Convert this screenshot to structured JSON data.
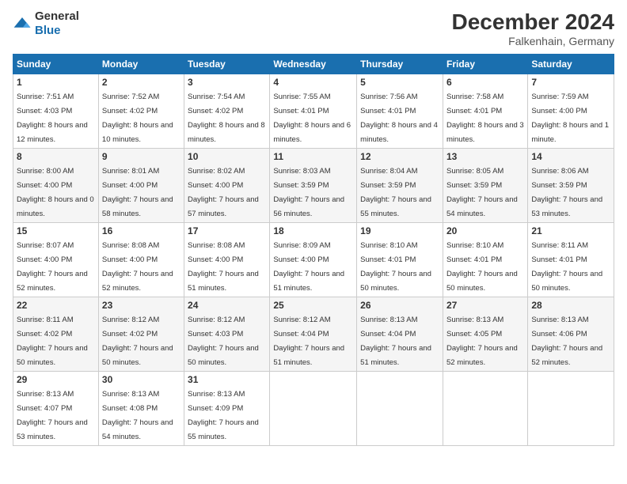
{
  "header": {
    "logo": {
      "general": "General",
      "blue": "Blue"
    },
    "title": "December 2024",
    "location": "Falkenhain, Germany"
  },
  "calendar": {
    "days_of_week": [
      "Sunday",
      "Monday",
      "Tuesday",
      "Wednesday",
      "Thursday",
      "Friday",
      "Saturday"
    ],
    "weeks": [
      [
        {
          "day": "1",
          "sunrise": "7:51 AM",
          "sunset": "4:03 PM",
          "daylight": "8 hours and 12 minutes."
        },
        {
          "day": "2",
          "sunrise": "7:52 AM",
          "sunset": "4:02 PM",
          "daylight": "8 hours and 10 minutes."
        },
        {
          "day": "3",
          "sunrise": "7:54 AM",
          "sunset": "4:02 PM",
          "daylight": "8 hours and 8 minutes."
        },
        {
          "day": "4",
          "sunrise": "7:55 AM",
          "sunset": "4:01 PM",
          "daylight": "8 hours and 6 minutes."
        },
        {
          "day": "5",
          "sunrise": "7:56 AM",
          "sunset": "4:01 PM",
          "daylight": "8 hours and 4 minutes."
        },
        {
          "day": "6",
          "sunrise": "7:58 AM",
          "sunset": "4:01 PM",
          "daylight": "8 hours and 3 minutes."
        },
        {
          "day": "7",
          "sunrise": "7:59 AM",
          "sunset": "4:00 PM",
          "daylight": "8 hours and 1 minute."
        }
      ],
      [
        {
          "day": "8",
          "sunrise": "8:00 AM",
          "sunset": "4:00 PM",
          "daylight": "8 hours and 0 minutes."
        },
        {
          "day": "9",
          "sunrise": "8:01 AM",
          "sunset": "4:00 PM",
          "daylight": "7 hours and 58 minutes."
        },
        {
          "day": "10",
          "sunrise": "8:02 AM",
          "sunset": "4:00 PM",
          "daylight": "7 hours and 57 minutes."
        },
        {
          "day": "11",
          "sunrise": "8:03 AM",
          "sunset": "3:59 PM",
          "daylight": "7 hours and 56 minutes."
        },
        {
          "day": "12",
          "sunrise": "8:04 AM",
          "sunset": "3:59 PM",
          "daylight": "7 hours and 55 minutes."
        },
        {
          "day": "13",
          "sunrise": "8:05 AM",
          "sunset": "3:59 PM",
          "daylight": "7 hours and 54 minutes."
        },
        {
          "day": "14",
          "sunrise": "8:06 AM",
          "sunset": "3:59 PM",
          "daylight": "7 hours and 53 minutes."
        }
      ],
      [
        {
          "day": "15",
          "sunrise": "8:07 AM",
          "sunset": "4:00 PM",
          "daylight": "7 hours and 52 minutes."
        },
        {
          "day": "16",
          "sunrise": "8:08 AM",
          "sunset": "4:00 PM",
          "daylight": "7 hours and 52 minutes."
        },
        {
          "day": "17",
          "sunrise": "8:08 AM",
          "sunset": "4:00 PM",
          "daylight": "7 hours and 51 minutes."
        },
        {
          "day": "18",
          "sunrise": "8:09 AM",
          "sunset": "4:00 PM",
          "daylight": "7 hours and 51 minutes."
        },
        {
          "day": "19",
          "sunrise": "8:10 AM",
          "sunset": "4:01 PM",
          "daylight": "7 hours and 50 minutes."
        },
        {
          "day": "20",
          "sunrise": "8:10 AM",
          "sunset": "4:01 PM",
          "daylight": "7 hours and 50 minutes."
        },
        {
          "day": "21",
          "sunrise": "8:11 AM",
          "sunset": "4:01 PM",
          "daylight": "7 hours and 50 minutes."
        }
      ],
      [
        {
          "day": "22",
          "sunrise": "8:11 AM",
          "sunset": "4:02 PM",
          "daylight": "7 hours and 50 minutes."
        },
        {
          "day": "23",
          "sunrise": "8:12 AM",
          "sunset": "4:02 PM",
          "daylight": "7 hours and 50 minutes."
        },
        {
          "day": "24",
          "sunrise": "8:12 AM",
          "sunset": "4:03 PM",
          "daylight": "7 hours and 50 minutes."
        },
        {
          "day": "25",
          "sunrise": "8:12 AM",
          "sunset": "4:04 PM",
          "daylight": "7 hours and 51 minutes."
        },
        {
          "day": "26",
          "sunrise": "8:13 AM",
          "sunset": "4:04 PM",
          "daylight": "7 hours and 51 minutes."
        },
        {
          "day": "27",
          "sunrise": "8:13 AM",
          "sunset": "4:05 PM",
          "daylight": "7 hours and 52 minutes."
        },
        {
          "day": "28",
          "sunrise": "8:13 AM",
          "sunset": "4:06 PM",
          "daylight": "7 hours and 52 minutes."
        }
      ],
      [
        {
          "day": "29",
          "sunrise": "8:13 AM",
          "sunset": "4:07 PM",
          "daylight": "7 hours and 53 minutes."
        },
        {
          "day": "30",
          "sunrise": "8:13 AM",
          "sunset": "4:08 PM",
          "daylight": "7 hours and 54 minutes."
        },
        {
          "day": "31",
          "sunrise": "8:13 AM",
          "sunset": "4:09 PM",
          "daylight": "7 hours and 55 minutes."
        },
        null,
        null,
        null,
        null
      ]
    ]
  }
}
